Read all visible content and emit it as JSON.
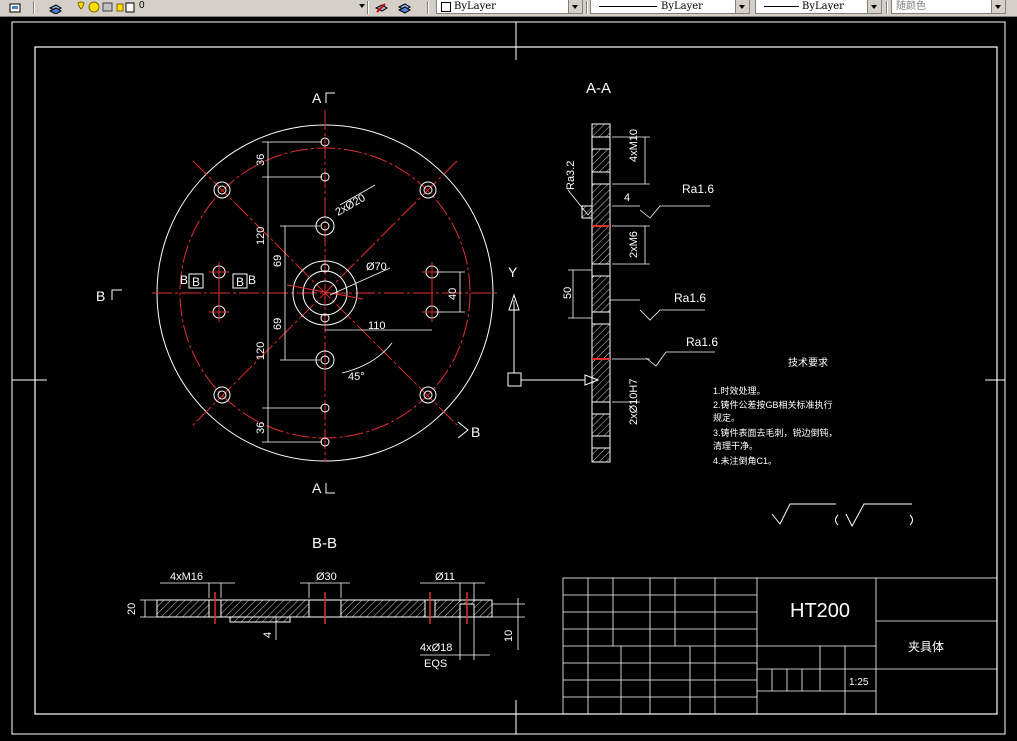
{
  "toolbar": {
    "layer_name": "0",
    "color": "ByLayer",
    "linetype": "ByLayer",
    "lineweight": "ByLayer",
    "plotstyle": "随颜色"
  },
  "drawing": {
    "section_aa": "A-A",
    "section_bb": "B-B",
    "cut_a_top": "A",
    "cut_a_bottom": "A",
    "cut_b_left": "B",
    "cut_b_right": "B",
    "ucs_y": "Y",
    "plan_dims": {
      "d36_top": "36",
      "d120_top": "120",
      "d69_top": "69",
      "d69_bot": "69",
      "d120_bot": "120",
      "d36_bot": "36",
      "holes_2xd20": "2xØ20",
      "d70": "Ø70",
      "d110": "110",
      "d40": "40",
      "angle45": "45°",
      "bb_b1": "B",
      "bb_b2": "B",
      "bb_b3": "B",
      "bb_b4": "B"
    },
    "aa_dims": {
      "m10": "4xM10",
      "ra32": "Ra3.2",
      "d4": "4",
      "ra16_1": "Ra1.6",
      "m6": "2xM6",
      "d50": "50",
      "ra16_2": "Ra1.6",
      "ra16_3": "Ra1.6",
      "d10": "2xØ10H7"
    },
    "bb_dims": {
      "m16": "4xM16",
      "d30": "Ø30",
      "d11": "Ø11",
      "d20": "20",
      "d4": "4",
      "d18": "4xØ18",
      "eqs": "EQS",
      "d10": "10"
    },
    "tech_notes": {
      "title": "技术要求",
      "n1": "1.时效处理。",
      "n2": "2.铸件公差按GB相关标准执行",
      "n2b": "规定。",
      "n3": "3.铸件表面去毛刺，锐边倒钝，",
      "n3b": "清理干净。",
      "n4": "4.未注倒角C1。"
    },
    "title_block": {
      "material": "HT200",
      "part_name": "夹具体",
      "scale": "1:25"
    }
  }
}
